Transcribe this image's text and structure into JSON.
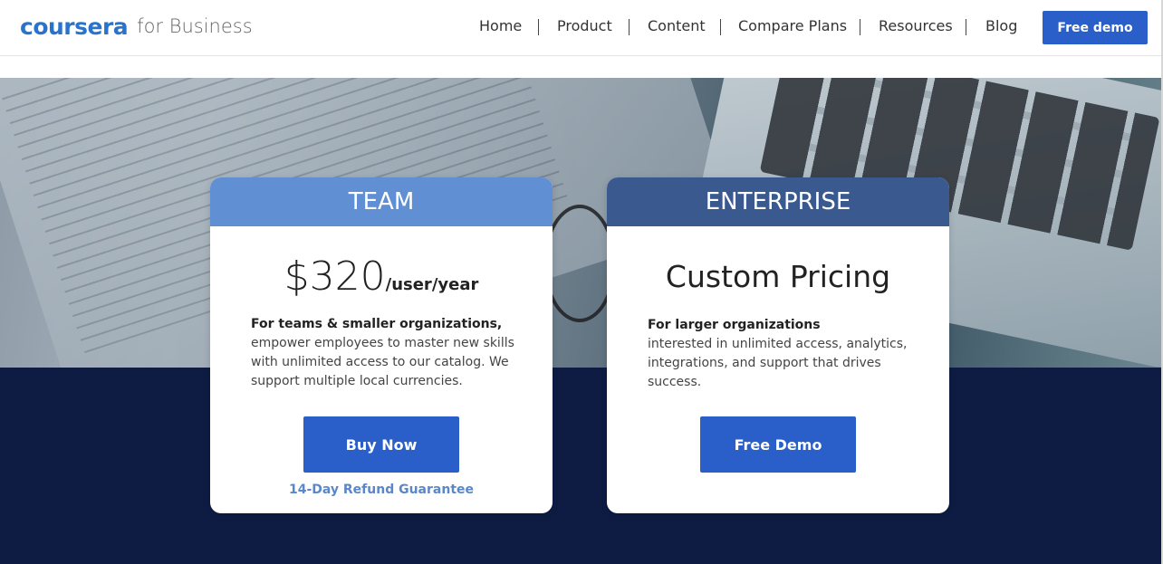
{
  "header": {
    "logo_word": "coursera",
    "logo_sub": "for Business",
    "nav": [
      "Home",
      "Product",
      "Content",
      "Compare Plans",
      "Resources",
      "Blog"
    ],
    "cta": "Free demo"
  },
  "plans": {
    "team": {
      "title": "TEAM",
      "price": "$320",
      "unit": "/user/year",
      "desc_bold": "For teams & smaller organizations,",
      "desc_rest": "empower employees to master new skills with unlimited access to our catalog. We support multiple local currencies.",
      "button": "Buy Now",
      "guarantee": "14-Day Refund Guarantee"
    },
    "enterprise": {
      "title": "ENTERPRISE",
      "price": "Custom Pricing",
      "desc_bold": "For larger organizations",
      "desc_rest": "interested in unlimited access, analytics, integrations, and support that drives success.",
      "button": "Free Demo"
    }
  },
  "colors": {
    "brand_blue": "#2a5fca",
    "team_header": "#6090d3",
    "enterprise_header": "#3a5a8f",
    "dark_band": "#0e1c44"
  }
}
